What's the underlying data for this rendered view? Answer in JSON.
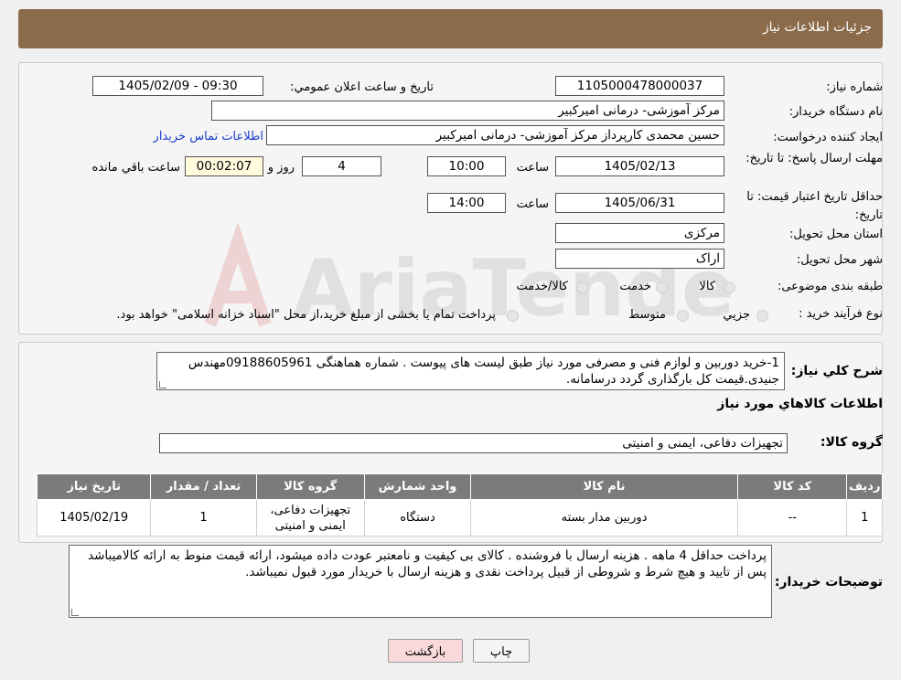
{
  "header": {
    "title": "جزئیات اطلاعات نیاز"
  },
  "watermark": {
    "text": "AriaTender.neT"
  },
  "form": {
    "need_number_label": "شماره نیاز:",
    "need_number": "1105000478000037",
    "announce_label": "تاريخ و ساعت اعلان عمومي:",
    "announce_value": "1405/02/09 - 09:30",
    "buyer_org_label": "نام دستگاه خريدار:",
    "buyer_org": "مرکز آموزشی- درمانی امیرکبیر",
    "requester_label": "ايجاد کننده درخواست:",
    "requester": "حسین  محمدی کارپرداز مرکز آموزشی- درمانی امیرکبیر",
    "contact_link": "اطلاعات تماس خريدار",
    "deadline_label": "مهلت ارسال پاسخ: تا تاريخ:",
    "deadline_date": "1405/02/13",
    "time_label": "ساعت",
    "deadline_time": "10:00",
    "days_value": "4",
    "days_label": "روز و",
    "remaining_time": "00:02:07",
    "remaining_label": "ساعت باقي مانده",
    "validity_label": "حداقل تاريخ اعتبار قيمت: تا تاريخ:",
    "validity_date": "1405/06/31",
    "validity_time": "14:00",
    "province_label": "استان محل تحويل:",
    "province": "مرکزی",
    "city_label": "شهر محل تحويل:",
    "city": "اراک",
    "category_label": "طبقه بندی موضوعی:",
    "category_options": [
      "کالا",
      "خدمت",
      "کالا/خدمت"
    ],
    "process_label": "نوع فرآيند خريد :",
    "process_options": [
      "جزیي",
      "متوسط"
    ],
    "process_note": "پرداخت تمام يا بخشی از مبلغ خريد،از محل \"اسناد خزانه اسلامی\" خواهد بود."
  },
  "description": {
    "label": "شرح کلي نياز:",
    "text": "1-خرید دوربین و لوازم فنی و مصرفی مورد نیاز طبق لیست های پیوست . شماره هماهنگی 09188605961مهندس جنیدی.قیمت کل بارگذاری گردد درسامانه."
  },
  "goods": {
    "section_title": "اطلاعات کالاهاي مورد نياز",
    "group_label": "گروه کالا:",
    "group_value": "تجهیزات دفاعی، ایمنی و امنیتی",
    "columns": [
      "رديف",
      "کد کالا",
      "نام کالا",
      "واحد شمارش",
      "گروه کالا",
      "تعداد / مقدار",
      "تاريخ نياز"
    ],
    "rows": [
      {
        "index": "1",
        "code": "--",
        "name": "دوربین مدار بسته",
        "unit": "دستگاه",
        "group": "تجهیزات دفاعی، ایمنی و امنیتی",
        "qty": "1",
        "date": "1405/02/19"
      }
    ]
  },
  "buyer_notes": {
    "label": "توضيحات خريدار:",
    "text": "پرداخت حداقل 4 ماهه . هزینه ارسال با فروشنده .  کالای بی کیفیت و نامعتبر عودت داده میشود، ارائه قیمت منوط به ارائه کالامیباشد پس از تایید و هیچ شرط و شروطی از قبیل پرداخت نقدی و هزینه ارسال با خریدار مورد قبول نمیباشد."
  },
  "buttons": {
    "print": "چاپ",
    "back": "بازگشت"
  },
  "colors": {
    "header": "#8b6b4a",
    "table_header": "#7b7b7b",
    "back_button": "#f9d9d9",
    "link": "#1a3ccf"
  }
}
